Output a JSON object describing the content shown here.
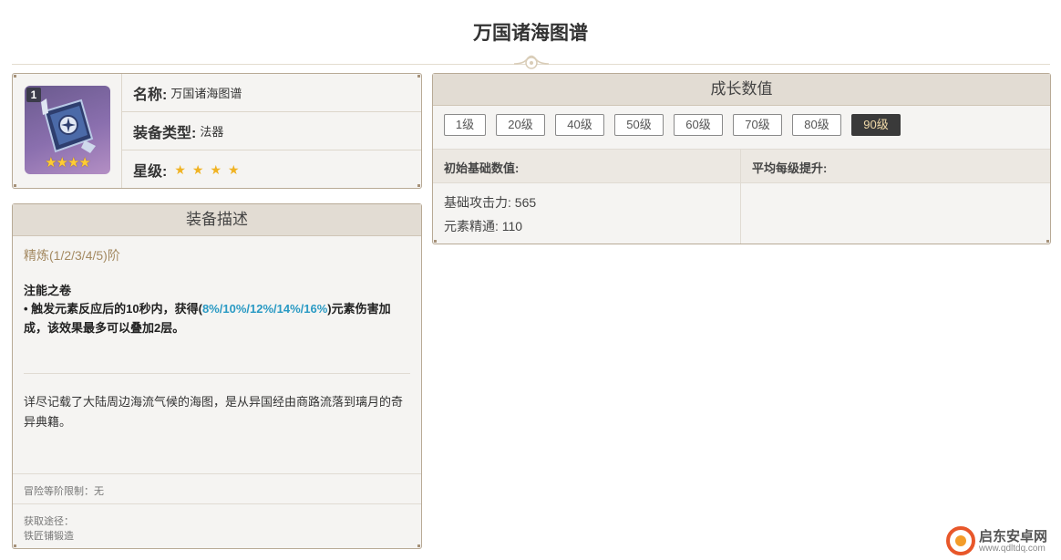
{
  "page": {
    "title": "万国诸海图谱"
  },
  "info": {
    "refine_badge": "1",
    "thumb_stars": "★★★★",
    "name_label": "名称:",
    "name_value": "万国诸海图谱",
    "type_label": "装备类型:",
    "type_value": "法器",
    "rarity_label": "星级:",
    "rarity_stars": "★★★★",
    "rarity_count": 4
  },
  "description": {
    "header": "装备描述",
    "refine_title": "精炼(1/2/3/4/5)阶",
    "skill_name": "注能之卷",
    "skill_prefix": "• 触发元素反应后的10秒内，获得(",
    "skill_highlight": "8%/10%/12%/14%/16%",
    "skill_suffix": ")元素伤害加成，该效果最多可以叠加2层。",
    "lore": "详尽记载了大陆周边海流气候的海图，是从异国经由商路流落到璃月的奇异典籍。",
    "rank_limit": "冒险等阶限制：无",
    "source_label": "获取途径：",
    "source_value": "铁匠铺锻造"
  },
  "growth": {
    "header": "成长数值",
    "levels": [
      "1级",
      "20级",
      "40级",
      "50级",
      "60级",
      "70级",
      "80级",
      "90级"
    ],
    "active_level": "90级",
    "base_header": "初始基础数值:",
    "per_level_header": "平均每级提升:",
    "base_atk": "基础攻击力: 565",
    "elemental_mastery": "元素精通: 110"
  },
  "watermark": {
    "name": "启东安卓网",
    "url": "www.qdltdq.com"
  },
  "colors": {
    "accent_gold": "#a48a62",
    "highlight_blue": "#2a9ac4",
    "active_tab_bg": "#3a3a3a",
    "star_gold": "#f0b323"
  },
  "icons": {
    "weapon": "catalyst-book-icon",
    "ornament": "title-ornament-icon",
    "watermark_logo": "watermark-logo-icon"
  }
}
